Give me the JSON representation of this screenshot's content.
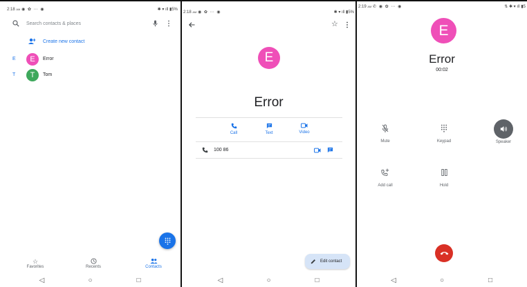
{
  "colors": {
    "accent": "#1a73e8",
    "pink_avatar": "#ef4fb8",
    "green_avatar": "#3ea85c",
    "end_call": "#d93025",
    "speaker_on": "#5f6368"
  },
  "screen1": {
    "status_time": "2:18",
    "status_ampm": "AM",
    "status_battery": "5%",
    "search_placeholder": "Search contacts & places",
    "create_new_contact": "Create new contact",
    "contacts": [
      {
        "section": "E",
        "initial": "E",
        "name": "Error"
      },
      {
        "section": "T",
        "initial": "T",
        "name": "Tom"
      }
    ],
    "tabs": [
      {
        "label": "Favorites",
        "icon": "star-icon"
      },
      {
        "label": "Recents",
        "icon": "clock-icon"
      },
      {
        "label": "Contacts",
        "icon": "people-icon"
      }
    ],
    "fab_icon": "dialpad-icon"
  },
  "screen2": {
    "status_time": "2:18",
    "status_ampm": "AM",
    "status_battery": "5%",
    "avatar_initial": "E",
    "contact_name": "Error",
    "actions": [
      {
        "label": "Call",
        "icon": "phone-icon"
      },
      {
        "label": "Text",
        "icon": "message-icon"
      },
      {
        "label": "Video",
        "icon": "video-icon"
      }
    ],
    "phone_number": "100 86",
    "edit_contact": "Edit contact"
  },
  "screen3": {
    "status_time": "2:19",
    "status_ampm": "AM",
    "status_battery": "5",
    "avatar_initial": "E",
    "caller_name": "Error",
    "call_timer": "00:02",
    "controls": [
      {
        "label": "Mute",
        "icon": "mic-off-icon"
      },
      {
        "label": "Keypad",
        "icon": "dialpad-icon"
      },
      {
        "label": "Speaker",
        "icon": "speaker-icon",
        "active": true
      },
      {
        "label": "Add call",
        "icon": "add-call-icon"
      },
      {
        "label": "Hold",
        "icon": "pause-icon"
      }
    ]
  },
  "nav_bar": {
    "back": "◁",
    "home": "○",
    "recents": "□"
  }
}
